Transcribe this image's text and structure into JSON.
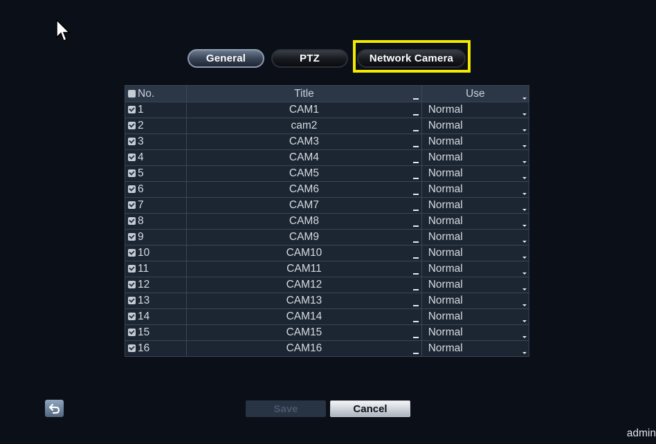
{
  "tabs": {
    "general": "General",
    "ptz": "PTZ",
    "network_camera": "Network Camera"
  },
  "table": {
    "headers": {
      "no": "No.",
      "title": "Title",
      "use": "Use"
    },
    "rows": [
      {
        "no": "1",
        "title": "CAM1",
        "use": "Normal"
      },
      {
        "no": "2",
        "title": "cam2",
        "use": "Normal"
      },
      {
        "no": "3",
        "title": "CAM3",
        "use": "Normal"
      },
      {
        "no": "4",
        "title": "CAM4",
        "use": "Normal"
      },
      {
        "no": "5",
        "title": "CAM5",
        "use": "Normal"
      },
      {
        "no": "6",
        "title": "CAM6",
        "use": "Normal"
      },
      {
        "no": "7",
        "title": "CAM7",
        "use": "Normal"
      },
      {
        "no": "8",
        "title": "CAM8",
        "use": "Normal"
      },
      {
        "no": "9",
        "title": "CAM9",
        "use": "Normal"
      },
      {
        "no": "10",
        "title": "CAM10",
        "use": "Normal"
      },
      {
        "no": "11",
        "title": "CAM11",
        "use": "Normal"
      },
      {
        "no": "12",
        "title": "CAM12",
        "use": "Normal"
      },
      {
        "no": "13",
        "title": "CAM13",
        "use": "Normal"
      },
      {
        "no": "14",
        "title": "CAM14",
        "use": "Normal"
      },
      {
        "no": "15",
        "title": "CAM15",
        "use": "Normal"
      },
      {
        "no": "16",
        "title": "CAM16",
        "use": "Normal"
      }
    ]
  },
  "buttons": {
    "save": "Save",
    "cancel": "Cancel"
  },
  "user": "admin",
  "colors": {
    "highlight": "#f2ea00",
    "background": "#0b0f17"
  }
}
